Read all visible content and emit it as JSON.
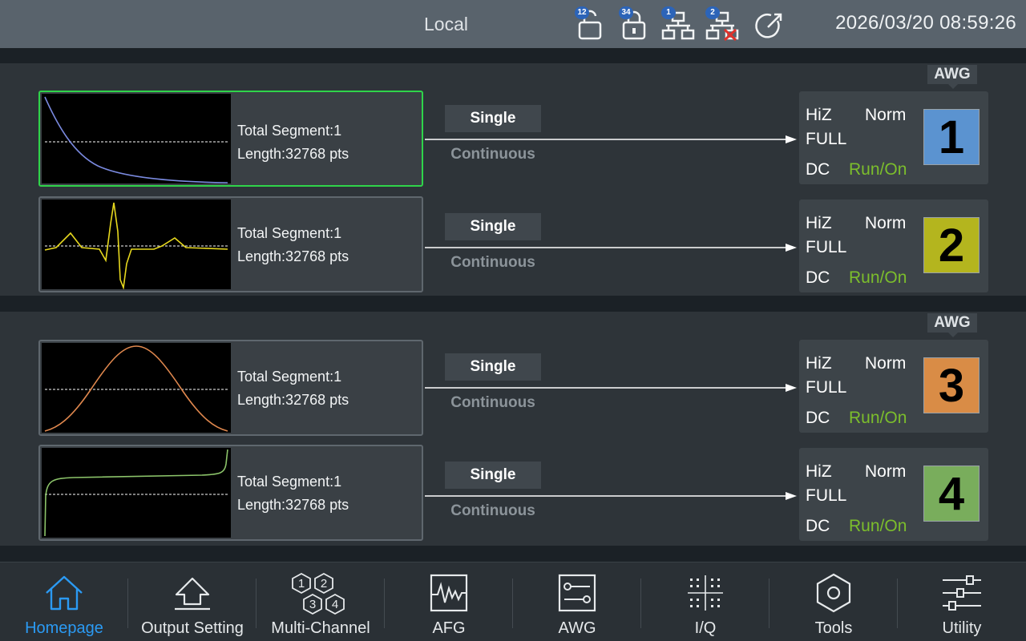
{
  "status_bar": {
    "mode": "Local",
    "datetime": "2026/03/20  08:59:26",
    "icons": [
      {
        "name": "lock-open-icon",
        "badge": "12"
      },
      {
        "name": "lock-closed-icon",
        "badge": "34"
      },
      {
        "name": "network-icon",
        "badge": "1"
      },
      {
        "name": "network-disconnected-icon",
        "badge": "2"
      },
      {
        "name": "trigger-icon",
        "badge": ""
      }
    ]
  },
  "groups": [
    {
      "tag": "AWG"
    },
    {
      "tag": "AWG"
    }
  ],
  "channels": [
    {
      "segment": "Total Segment:1",
      "length": "Length:32768 pts",
      "mode_single": "Single",
      "mode_continuous": "Continuous",
      "impedance": "HiZ",
      "polarity": "Norm",
      "range": "FULL",
      "coupling": "DC",
      "state": "Run/On",
      "number": "1",
      "color": "#5b93d0",
      "wave_color": "#7a8ae0",
      "waveform": "exponential-decay",
      "selected": true
    },
    {
      "segment": "Total Segment:1",
      "length": "Length:32768 pts",
      "mode_single": "Single",
      "mode_continuous": "Continuous",
      "impedance": "HiZ",
      "polarity": "Norm",
      "range": "FULL",
      "coupling": "DC",
      "state": "Run/On",
      "number": "2",
      "color": "#b4b51e",
      "wave_color": "#e6d81e",
      "waveform": "cardiac-pulse",
      "selected": false
    },
    {
      "segment": "Total Segment:1",
      "length": "Length:32768 pts",
      "mode_single": "Single",
      "mode_continuous": "Continuous",
      "impedance": "HiZ",
      "polarity": "Norm",
      "range": "FULL",
      "coupling": "DC",
      "state": "Run/On",
      "number": "3",
      "color": "#d98c46",
      "wave_color": "#e0884e",
      "waveform": "raised-cosine",
      "selected": false
    },
    {
      "segment": "Total Segment:1",
      "length": "Length:32768 pts",
      "mode_single": "Single",
      "mode_continuous": "Continuous",
      "impedance": "HiZ",
      "polarity": "Norm",
      "range": "FULL",
      "coupling": "DC",
      "state": "Run/On",
      "number": "4",
      "color": "#79ad5c",
      "wave_color": "#8cc46a",
      "waveform": "tangent",
      "selected": false
    }
  ],
  "nav": [
    {
      "label": "Homepage",
      "icon": "home-icon",
      "active": true
    },
    {
      "label": "Output Setting",
      "icon": "output-setting-icon",
      "active": false
    },
    {
      "label": "Multi-Channel",
      "icon": "multi-channel-icon",
      "active": false
    },
    {
      "label": "AFG",
      "icon": "afg-waveform-icon",
      "active": false
    },
    {
      "label": "AWG",
      "icon": "awg-sliders-icon",
      "active": false
    },
    {
      "label": "I/Q",
      "icon": "iq-constellation-icon",
      "active": false
    },
    {
      "label": "Tools",
      "icon": "tools-hexagon-icon",
      "active": false
    },
    {
      "label": "Utility",
      "icon": "utility-sliders-icon",
      "active": false
    }
  ]
}
